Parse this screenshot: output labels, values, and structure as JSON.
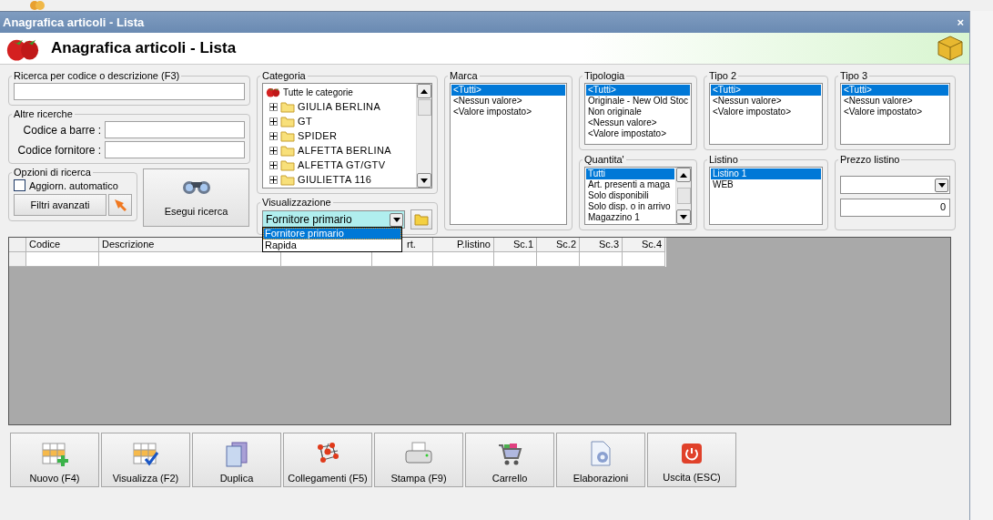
{
  "window": {
    "title": "Anagrafica articoli  - Lista",
    "close": "×"
  },
  "header": {
    "title": "Anagrafica articoli  - Lista"
  },
  "search": {
    "label": "Ricerca per codice o descrizione (F3)"
  },
  "other_searches": {
    "label": "Altre ricerche",
    "fields": [
      {
        "label": "Codice a barre :"
      },
      {
        "label": "Codice fornitore :"
      }
    ]
  },
  "options": {
    "label": "Opzioni di ricerca",
    "auto_update": {
      "label": "Aggiorn. automatico",
      "checked": false
    },
    "advanced_filters": "Filtri avanzati"
  },
  "run_search": "Esegui ricerca",
  "category": {
    "label": "Categoria",
    "root": {
      "label": "Tutte le categorie",
      "children": [
        {
          "label": "GIULIA BERLINA",
          "expanded": false
        },
        {
          "label": "GT",
          "expanded": false
        },
        {
          "label": "SPIDER",
          "expanded": false
        },
        {
          "label": "ALFETTA BERLINA",
          "expanded": false
        },
        {
          "label": "ALFETTA GT/GTV",
          "expanded": false
        },
        {
          "label": "GIULIETTA 116",
          "expanded": false
        }
      ]
    }
  },
  "view": {
    "label": "Visualizzazione",
    "value": "Fornitore primario",
    "expanded": true,
    "options": [
      {
        "label": "Fornitore primario",
        "selected": true
      },
      {
        "label": "Rapida",
        "selected": false
      }
    ]
  },
  "filters": [
    {
      "label": "Marca",
      "items": [
        {
          "label": "<Tutti>",
          "selected": true
        },
        {
          "label": "<Nessun valore>",
          "selected": false
        },
        {
          "label": "<Valore impostato>",
          "selected": false
        }
      ]
    },
    {
      "label": "Tipologia",
      "items": [
        {
          "label": "<Tutti>",
          "selected": true
        },
        {
          "label": "Originale - New Old Stoc",
          "selected": false
        },
        {
          "label": "Non originale",
          "selected": false
        },
        {
          "label": "<Nessun valore>",
          "selected": false
        },
        {
          "label": "<Valore impostato>",
          "selected": false
        }
      ]
    },
    {
      "label": "Tipo 2",
      "items": [
        {
          "label": "<Tutti>",
          "selected": true
        },
        {
          "label": "<Nessun valore>",
          "selected": false
        },
        {
          "label": "<Valore impostato>",
          "selected": false
        }
      ]
    },
    {
      "label": "Tipo 3",
      "items": [
        {
          "label": "<Tutti>",
          "selected": true
        },
        {
          "label": "<Nessun valore>",
          "selected": false
        },
        {
          "label": "<Valore impostato>",
          "selected": false
        }
      ]
    },
    {
      "label": "Quantita'",
      "items": [
        {
          "label": "Tutti",
          "selected": true
        },
        {
          "label": "Art. presenti a maga",
          "selected": false
        },
        {
          "label": "Solo disponibili",
          "selected": false
        },
        {
          "label": "Solo disp. o in arrivo",
          "selected": false
        },
        {
          "label": "Magazzino 1",
          "selected": false
        }
      ]
    },
    {
      "label": "Listino",
      "items": [
        {
          "label": "Listino 1",
          "selected": true
        },
        {
          "label": "WEB",
          "selected": false
        }
      ]
    }
  ],
  "price_list": {
    "label": "Prezzo listino",
    "amount": "0"
  },
  "table": {
    "columns": [
      {
        "label": "Codice"
      },
      {
        "label": "Descrizione"
      },
      {},
      {
        "label": "rt."
      },
      {
        "label": "P.listino"
      },
      {
        "label": "Sc.1"
      },
      {
        "label": "Sc.2"
      },
      {
        "label": "Sc.3"
      },
      {
        "label": "Sc.4"
      }
    ]
  },
  "toolbar": [
    "Nuovo (F4)",
    "Visualizza (F2)",
    "Duplica",
    "Collegamenti (F5)",
    "Stampa (F9)",
    "Carrello",
    "Elaborazioni",
    "Uscita (ESC)"
  ]
}
